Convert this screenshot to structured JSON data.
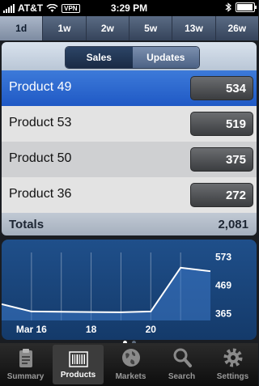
{
  "status": {
    "carrier": "AT&T",
    "vpn": "VPN",
    "time": "3:29 PM"
  },
  "ranges": [
    "1d",
    "1w",
    "2w",
    "5w",
    "13w",
    "26w"
  ],
  "active_range": "1d",
  "segment": {
    "sales": "Sales",
    "updates": "Updates",
    "selected": "Sales"
  },
  "products": [
    {
      "name": "Product 49",
      "value": "534"
    },
    {
      "name": "Product 53",
      "value": "519"
    },
    {
      "name": "Product 50",
      "value": "375"
    },
    {
      "name": "Product 36",
      "value": "272"
    }
  ],
  "totals": {
    "label": "Totals",
    "value": "2,081"
  },
  "chart_data": {
    "type": "area",
    "y_ticks": [
      "573",
      "469",
      "365"
    ],
    "x_ticks": [
      "Mar 16",
      "18",
      "20"
    ],
    "values": [
      400,
      373,
      372,
      371,
      370,
      373,
      534,
      521
    ],
    "ylim": [
      340,
      590
    ],
    "grid": true
  },
  "page_dots": {
    "count": 2,
    "active": 0
  },
  "tabs": [
    {
      "label": "Summary",
      "icon": "clipboard-icon"
    },
    {
      "label": "Products",
      "icon": "barcode-icon"
    },
    {
      "label": "Markets",
      "icon": "globe-icon"
    },
    {
      "label": "Search",
      "icon": "magnifier-icon"
    },
    {
      "label": "Settings",
      "icon": "gear-icon"
    }
  ],
  "active_tab": "Products"
}
